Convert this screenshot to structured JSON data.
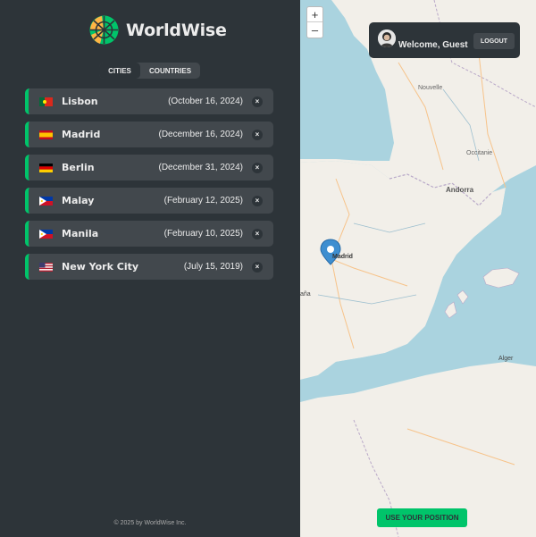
{
  "app": {
    "name": "WorldWise"
  },
  "tabs": [
    {
      "label": "CITIES",
      "active": true
    },
    {
      "label": "COUNTRIES",
      "active": false
    }
  ],
  "cities": [
    {
      "name": "Lisbon",
      "date": "(October 16, 2024)",
      "flag": "portugal-flag-icon"
    },
    {
      "name": "Madrid",
      "date": "(December 16, 2024)",
      "flag": "spain-flag-icon"
    },
    {
      "name": "Berlin",
      "date": "(December 31, 2024)",
      "flag": "germany-flag-icon"
    },
    {
      "name": "Malay",
      "date": "(February 12, 2025)",
      "flag": "philippines-flag-icon"
    },
    {
      "name": "Manila",
      "date": "(February 10, 2025)",
      "flag": "philippines-flag-icon"
    },
    {
      "name": "New York City",
      "date": "(July 15, 2019)",
      "flag": "usa-flag-icon"
    }
  ],
  "delete_symbol": "×",
  "footer": "© 2025 by WorldWise Inc.",
  "map": {
    "zoom_in": "+",
    "zoom_out": "–",
    "marker_label": "Madrid",
    "place_labels": {
      "andorra": "Andorra",
      "alger": "Alger",
      "espana": "aña",
      "nouvelle": "Nouvelle",
      "occitanie": "Occitanie"
    }
  },
  "user": {
    "welcome": "Welcome, Guest",
    "logout": "LOGOUT"
  },
  "use_position": "USE YOUR POSITION",
  "colors": {
    "brand_green": "#00c46a",
    "dark": "#2d3439",
    "medium": "#42484d",
    "light": "#ececec",
    "sea": "#aad3df",
    "land": "#f2efe9"
  }
}
